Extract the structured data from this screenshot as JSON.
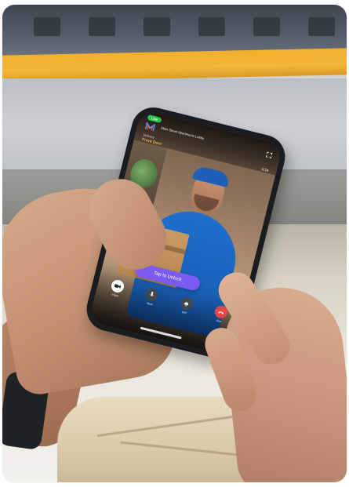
{
  "photo": {
    "description_tags": [
      "train-background",
      "hands",
      "smartphone"
    ]
  },
  "phone_screen": {
    "call_pill": "Live",
    "device_name": "Main Street Apartments Lobby",
    "sub_label": "Delivery",
    "door_label": "Front Door",
    "timer": "0:24",
    "unlock_button": "Tap to Unlock",
    "controls": [
      {
        "label": "Video",
        "icon": "video-icon"
      },
      {
        "label": "Mute",
        "icon": "mic-icon"
      },
      {
        "label": "Bell",
        "icon": "bell-icon"
      },
      {
        "label": "End",
        "icon": "phone-end-icon"
      }
    ],
    "colors": {
      "accent": "#7b5cf0",
      "door_label": "#f3b44b",
      "live": "#2ec24a",
      "end_call": "#e54646"
    }
  }
}
